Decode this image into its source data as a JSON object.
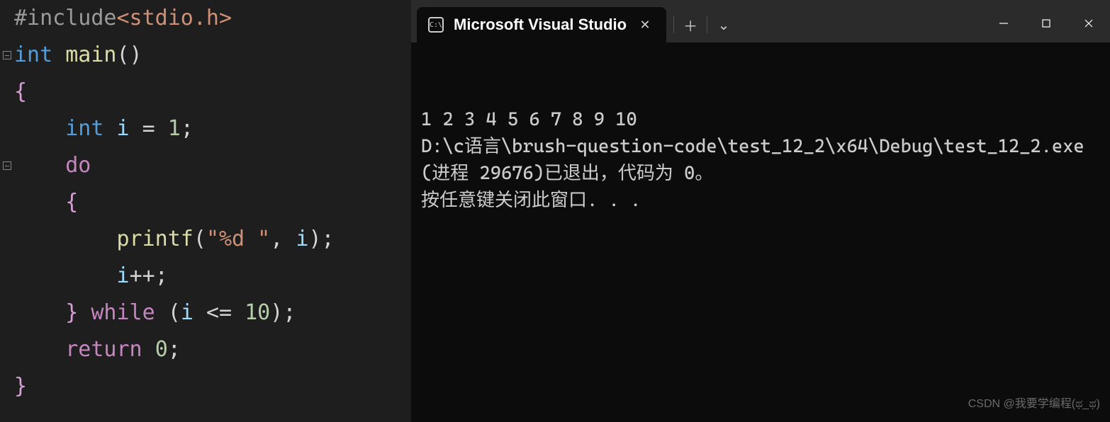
{
  "editor": {
    "code_lines": [
      {
        "segments": [
          {
            "cls": "tok-preproc",
            "t": "#include"
          },
          {
            "cls": "tok-include-path",
            "t": "<stdio.h>"
          }
        ]
      },
      {
        "segments": [
          {
            "cls": "tok-type",
            "t": "int"
          },
          {
            "cls": "tok-plain",
            "t": " "
          },
          {
            "cls": "tok-func",
            "t": "main"
          },
          {
            "cls": "tok-paren",
            "t": "()"
          }
        ]
      },
      {
        "segments": [
          {
            "cls": "tok-brace",
            "t": "{"
          }
        ]
      },
      {
        "segments": [
          {
            "cls": "tok-plain",
            "t": "    "
          },
          {
            "cls": "tok-type",
            "t": "int"
          },
          {
            "cls": "tok-plain",
            "t": " "
          },
          {
            "cls": "tok-var",
            "t": "i"
          },
          {
            "cls": "tok-plain",
            "t": " "
          },
          {
            "cls": "tok-op",
            "t": "="
          },
          {
            "cls": "tok-plain",
            "t": " "
          },
          {
            "cls": "tok-num",
            "t": "1"
          },
          {
            "cls": "tok-plain",
            "t": ";"
          }
        ]
      },
      {
        "segments": [
          {
            "cls": "tok-plain",
            "t": "    "
          },
          {
            "cls": "tok-loop",
            "t": "do"
          }
        ]
      },
      {
        "segments": [
          {
            "cls": "tok-plain",
            "t": "    "
          },
          {
            "cls": "tok-brace",
            "t": "{"
          }
        ]
      },
      {
        "segments": [
          {
            "cls": "tok-plain",
            "t": "        "
          },
          {
            "cls": "tok-func",
            "t": "printf"
          },
          {
            "cls": "tok-paren",
            "t": "("
          },
          {
            "cls": "tok-str",
            "t": "\"%d \""
          },
          {
            "cls": "tok-plain",
            "t": ", "
          },
          {
            "cls": "tok-var",
            "t": "i"
          },
          {
            "cls": "tok-paren",
            "t": ")"
          },
          {
            "cls": "tok-plain",
            "t": ";"
          }
        ]
      },
      {
        "segments": [
          {
            "cls": "tok-plain",
            "t": "        "
          },
          {
            "cls": "tok-var",
            "t": "i"
          },
          {
            "cls": "tok-op",
            "t": "++"
          },
          {
            "cls": "tok-plain",
            "t": ";"
          }
        ]
      },
      {
        "segments": [
          {
            "cls": "tok-plain",
            "t": "    "
          },
          {
            "cls": "tok-brace",
            "t": "}"
          },
          {
            "cls": "tok-plain",
            "t": " "
          },
          {
            "cls": "tok-loop",
            "t": "while"
          },
          {
            "cls": "tok-plain",
            "t": " "
          },
          {
            "cls": "tok-paren",
            "t": "("
          },
          {
            "cls": "tok-var",
            "t": "i"
          },
          {
            "cls": "tok-plain",
            "t": " "
          },
          {
            "cls": "tok-op",
            "t": "<="
          },
          {
            "cls": "tok-plain",
            "t": " "
          },
          {
            "cls": "tok-num",
            "t": "10"
          },
          {
            "cls": "tok-paren",
            "t": ")"
          },
          {
            "cls": "tok-plain",
            "t": ";"
          }
        ]
      },
      {
        "segments": [
          {
            "cls": "tok-plain",
            "t": "    "
          },
          {
            "cls": "tok-flow",
            "t": "return"
          },
          {
            "cls": "tok-plain",
            "t": " "
          },
          {
            "cls": "tok-num",
            "t": "0"
          },
          {
            "cls": "tok-plain",
            "t": ";"
          }
        ]
      },
      {
        "segments": [
          {
            "cls": "tok-brace",
            "t": "}"
          }
        ]
      }
    ],
    "fold_markers": [
      {
        "line_index": 1
      },
      {
        "line_index": 4
      }
    ]
  },
  "terminal": {
    "tab_title": "Microsoft Visual Studio",
    "tab_icon_text": "C:\\",
    "output_lines": [
      "1 2 3 4 5 6 7 8 9 10",
      "D:\\c语言\\brush-question-code\\test_12_2\\x64\\Debug\\test_12_2.exe (进程 29676)已退出，代码为 0。",
      "按任意键关闭此窗口. . ."
    ]
  },
  "watermark": "CSDN @我要学编程(ಥ_ಥ)",
  "icons": {
    "close_x": "✕",
    "plus": "＋",
    "chevron_down": "⌄"
  }
}
